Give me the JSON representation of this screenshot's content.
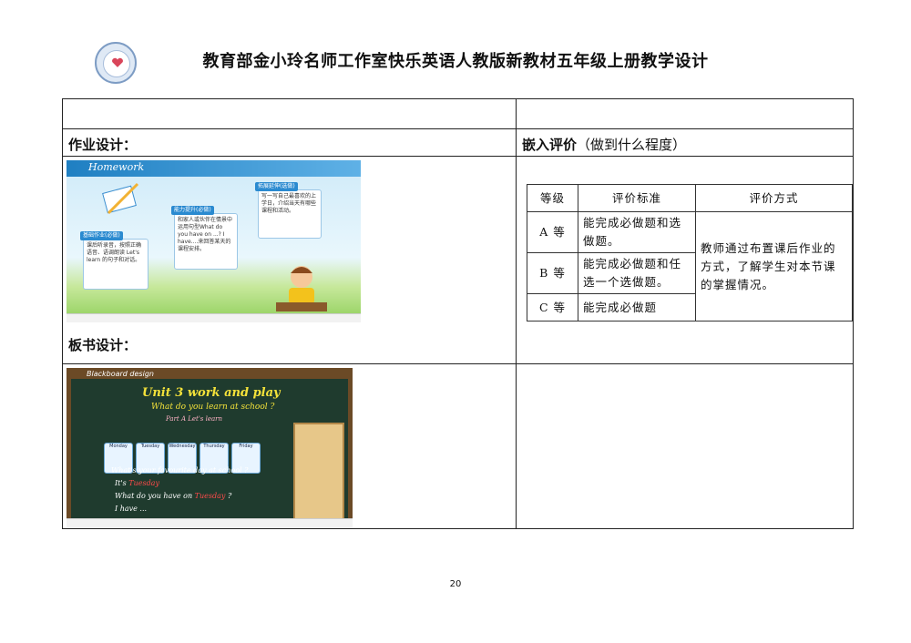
{
  "header": {
    "title": "教育部金小玲名师工作室快乐英语人教版新教材五年级上册教学设计"
  },
  "sections": {
    "homework_label": "作业设计：",
    "board_label": "板书设计：",
    "eval_label_main": "嵌入评价",
    "eval_label_sub": "（做到什么程度）"
  },
  "homework_slide": {
    "banner": "Homework",
    "card1_tag": "基础作业(必做)",
    "card1_text": "课后听录音，按照正确语音、语调朗读 Let's learn 的句子和对话。",
    "card2_tag": "能力提升(必做)",
    "card2_text": "和家人或伙伴在情景中运用句型What do you have on ...? I have....来回答某天的课程安排。",
    "card3_tag": "拓展延伸(选做)",
    "card3_text": "写一写自己最喜欢的上学日，介绍当天有哪些课程和活动。"
  },
  "board_slide": {
    "banner": "Blackboard design",
    "title": "Unit 3  work and play",
    "question": "What do you learn at school ?",
    "part": "Part A  Let's learn",
    "days": [
      "Monday",
      "Tuesday",
      "Wednesday",
      "Thursday",
      "Friday"
    ],
    "line1": "What's your favourite day at school ?",
    "line2a": "It's",
    "line2b": "Tuesday",
    "line3a": "What do you have on",
    "line3b": "Tuesday",
    "line4": "I have ..."
  },
  "evaluation": {
    "headers": [
      "等级",
      "评价标准",
      "评价方式"
    ],
    "rows": [
      {
        "grade": "A 等",
        "criteria": "能完成必做题和选做题。"
      },
      {
        "grade": "B 等",
        "criteria": "能完成必做题和任选一个选做题。"
      },
      {
        "grade": "C 等",
        "criteria": "能完成必做题"
      }
    ],
    "method": "教师通过布置课后作业的方式，了解学生对本节课的掌握情况。"
  },
  "footer": {
    "page_number": "20"
  },
  "colors": {
    "accent_blue": "#1f7fc2",
    "board_green": "#1f3b2e",
    "chalk_red": "#ff4a4a"
  }
}
